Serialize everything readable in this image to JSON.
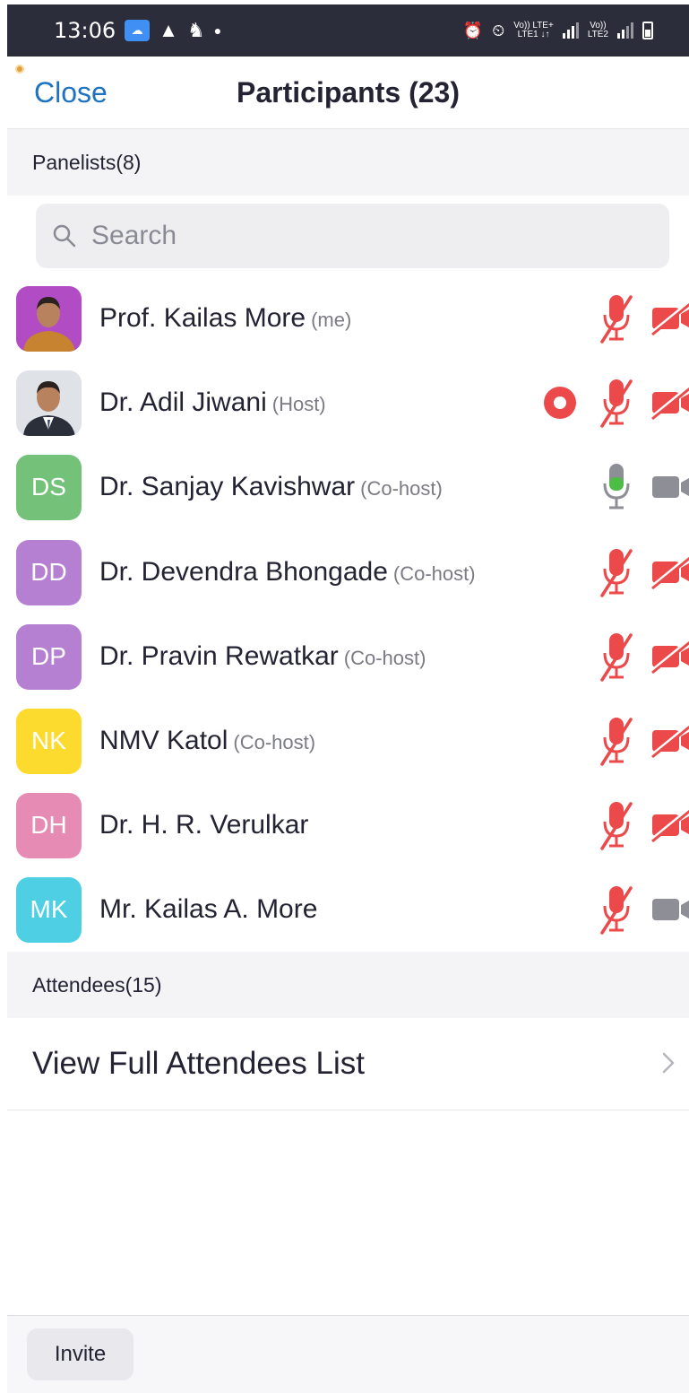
{
  "status_bar": {
    "time": "13:06",
    "net1_top": "Vo)) LTE+",
    "net1_bottom": "LTE1 ↓↑",
    "net2_top": "Vo))",
    "net2_bottom": "LTE2"
  },
  "header": {
    "close_label": "Close",
    "title": "Participants (23)"
  },
  "panelists_section": {
    "label": "Panelists(8)"
  },
  "search": {
    "placeholder": "Search"
  },
  "panelists": [
    {
      "name": "Prof. Kailas More",
      "role": "(me)",
      "avatar_type": "photo",
      "initials": "",
      "mic": "muted",
      "video": "off",
      "recording": false
    },
    {
      "name": "Dr. Adil Jiwani",
      "role": "(Host)",
      "avatar_type": "photo",
      "initials": "",
      "mic": "muted",
      "video": "off",
      "recording": true
    },
    {
      "name": "Dr. Sanjay Kavishwar",
      "role": "(Co-host)",
      "avatar_type": "initials",
      "initials": "DS",
      "avatar_color": "#74c27a",
      "mic": "active",
      "video": "on",
      "recording": false
    },
    {
      "name": "Dr. Devendra Bhongade",
      "role": "(Co-host)",
      "avatar_type": "initials",
      "initials": "DD",
      "avatar_color": "#b580d1",
      "mic": "muted",
      "video": "off",
      "recording": false
    },
    {
      "name": "Dr. Pravin Rewatkar",
      "role": "(Co-host)",
      "avatar_type": "initials",
      "initials": "DP",
      "avatar_color": "#b580d1",
      "mic": "muted",
      "video": "off",
      "recording": false
    },
    {
      "name": "NMV Katol",
      "role": "(Co-host)",
      "avatar_type": "initials",
      "initials": "NK",
      "avatar_color": "#fcdb2e",
      "mic": "muted",
      "video": "off",
      "recording": false
    },
    {
      "name": "Dr. H. R. Verulkar",
      "role": "",
      "avatar_type": "initials",
      "initials": "DH",
      "avatar_color": "#e68cb4",
      "mic": "muted",
      "video": "off",
      "recording": false
    },
    {
      "name": "Mr. Kailas A. More",
      "role": "",
      "avatar_type": "initials",
      "initials": "MK",
      "avatar_color": "#4fcfe3",
      "mic": "muted",
      "video": "on",
      "recording": false
    }
  ],
  "attendees_section": {
    "label": "Attendees(15)"
  },
  "attendees_link": {
    "label": "View Full Attendees List"
  },
  "footer": {
    "invite_label": "Invite"
  },
  "colors": {
    "accent_blue": "#1e72c2",
    "muted_red": "#ec4a4a",
    "active_green": "#4cbd45",
    "icon_gray": "#8e8e96",
    "status_bar": "#2c2d3b"
  }
}
